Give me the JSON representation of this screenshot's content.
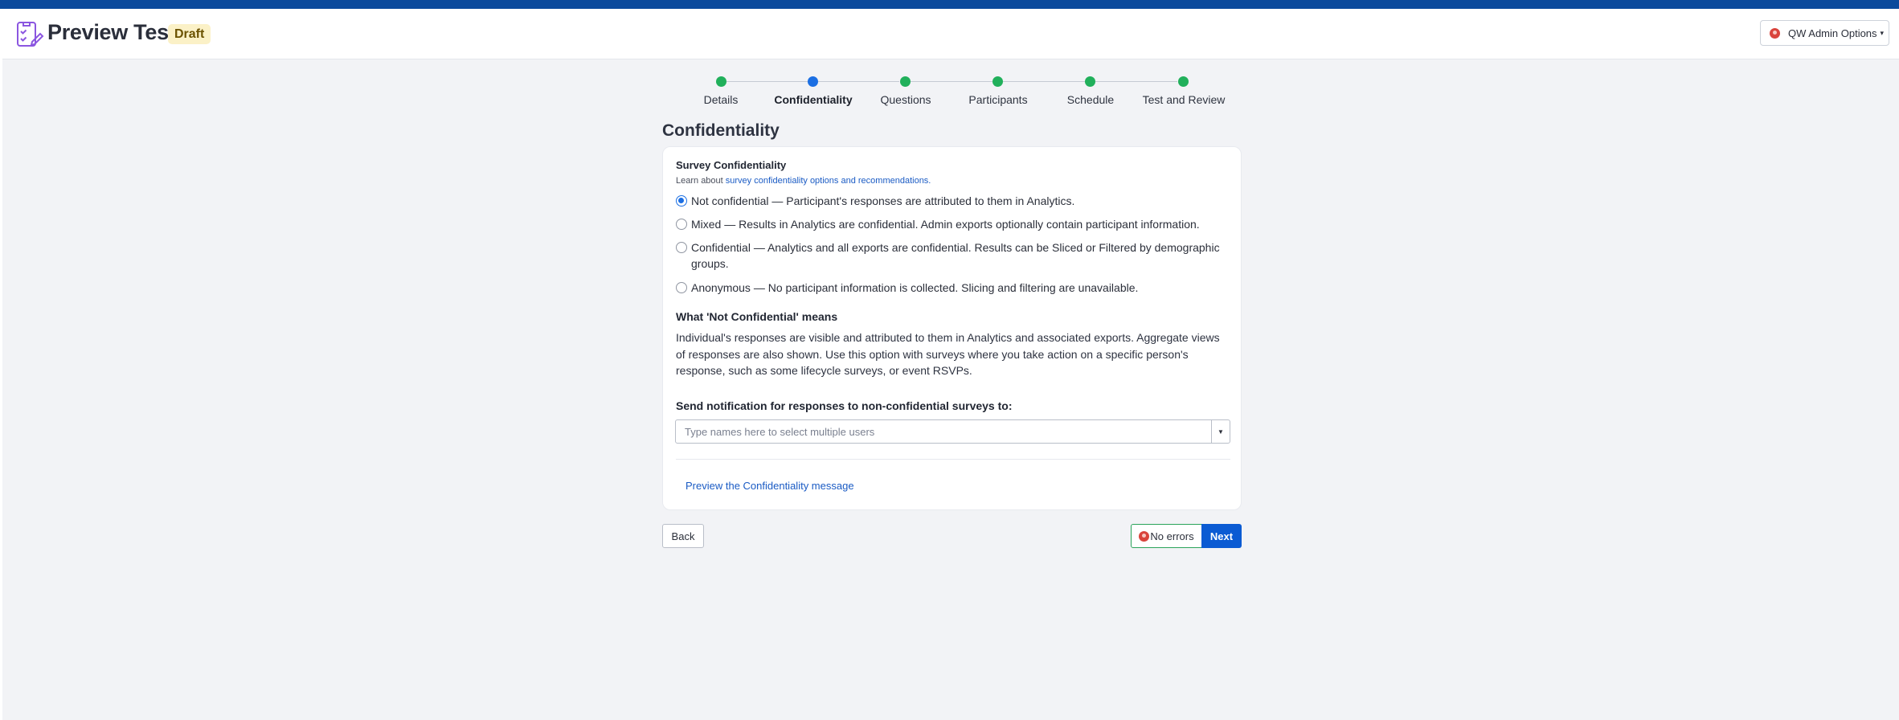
{
  "header": {
    "title": "Preview Test",
    "status_badge": "Draft",
    "admin_button_label": "QW Admin Options"
  },
  "colors": {
    "top_accent": "#0b4a9c",
    "step_done": "#21b05b",
    "step_active": "#1c6fe3",
    "primary_button": "#0b5bd3",
    "link": "#1a5bc4"
  },
  "stepper": {
    "steps": [
      {
        "label": "Details",
        "state": "done"
      },
      {
        "label": "Confidentiality",
        "state": "active"
      },
      {
        "label": "Questions",
        "state": "done"
      },
      {
        "label": "Participants",
        "state": "done"
      },
      {
        "label": "Schedule",
        "state": "done"
      },
      {
        "label": "Test and Review",
        "state": "done"
      }
    ]
  },
  "section": {
    "title": "Confidentiality"
  },
  "card": {
    "heading": "Survey Confidentiality",
    "learn_prefix": "Learn about ",
    "learn_link": "survey confidentiality options and recommendations.",
    "options": [
      {
        "label": "Not confidential — Participant's responses are attributed to them in Analytics.",
        "checked": true
      },
      {
        "label": "Mixed — Results in Analytics are confidential. Admin exports optionally contain participant information.",
        "checked": false
      },
      {
        "label": "Confidential — Analytics and all exports are confidential. Results can be Sliced or Filtered by demographic groups.",
        "checked": false
      },
      {
        "label": "Anonymous — No participant information is collected. Slicing and filtering are unavailable.",
        "checked": false
      }
    ],
    "meaning_title": "What 'Not Confidential' means",
    "meaning_text": "Individual's responses are visible and attributed to them in Analytics and associated exports. Aggregate views of responses are also shown. Use this option with surveys where you take action on a specific person's response, such as some lifecycle surveys, or event RSVPs.",
    "notify_label": "Send notification for responses to non-confidential surveys to:",
    "user_select_placeholder": "Type names here to select multiple users",
    "user_select_value": "",
    "preview_link": "Preview the Confidentiality message"
  },
  "footer": {
    "back_label": "Back",
    "errors_label": "No errors",
    "next_label": "Next"
  }
}
